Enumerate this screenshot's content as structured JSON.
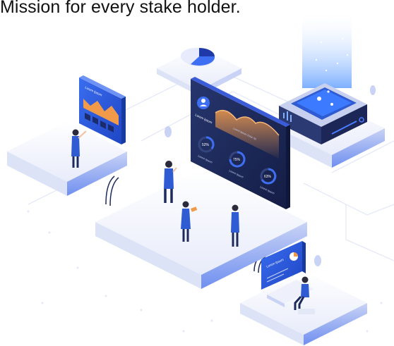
{
  "headline": "Mission for every stake holder.",
  "illustration": {
    "alt": "isometric dashboard team illustration",
    "main_panel": {
      "header_label": "Lorem Ipsum",
      "chart_label": "Lorem Ipsum Dolor Sit",
      "gauges": [
        {
          "value": "52%",
          "label": "Lorem Ipsum"
        },
        {
          "value": "75%",
          "label": "Lorem Ipsum"
        },
        {
          "value": "63%",
          "label": "Lorem Ipsum"
        }
      ]
    },
    "left_board_label": "Lorem Ipsum",
    "desk_monitor_label": "Lorem Ipsum",
    "colors": {
      "accent": "#2f5bd3",
      "panel_dark": "#1d2a5c",
      "platform": "#eef1fb",
      "chart_orange": "#f19a4a"
    }
  }
}
